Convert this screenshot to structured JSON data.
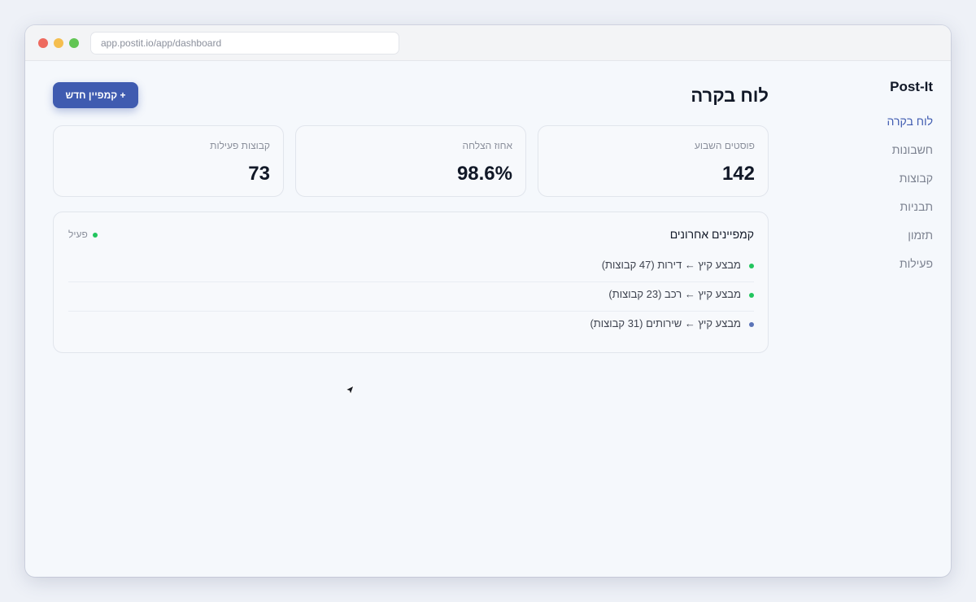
{
  "browser": {
    "url": "app.postit.io/app/dashboard"
  },
  "sidebar": {
    "brand": "Post-It",
    "items": [
      {
        "label": "לוח בקרה",
        "active": true
      },
      {
        "label": "חשבונות",
        "active": false
      },
      {
        "label": "קבוצות",
        "active": false
      },
      {
        "label": "תבניות",
        "active": false
      },
      {
        "label": "תזמון",
        "active": false
      },
      {
        "label": "פעילות",
        "active": false
      }
    ]
  },
  "header": {
    "title": "לוח בקרה",
    "new_campaign_label": "+ קמפיין חדש"
  },
  "stats": [
    {
      "label": "פוסטים השבוע",
      "value": "142"
    },
    {
      "label": "אחוז הצלחה",
      "value": "98.6%"
    },
    {
      "label": "קבוצות פעילות",
      "value": "73"
    }
  ],
  "campaigns": {
    "title": "קמפיינים אחרונים",
    "status": "פעיל",
    "rows": [
      {
        "text": "מבצע קיץ ← דירות (47 קבוצות)",
        "color": "#22c55e"
      },
      {
        "text": "מבצע קיץ ← רכב (23 קבוצות)",
        "color": "#22c55e"
      },
      {
        "text": "מבצע קיץ ← שירותים (31 קבוצות)",
        "color": "#5b74b8"
      }
    ]
  },
  "colors": {
    "accent": "#3f5bb0",
    "active_green": "#22c55e"
  }
}
